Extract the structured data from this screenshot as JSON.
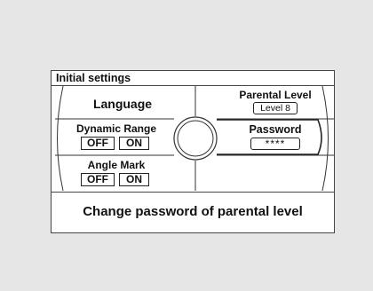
{
  "title": "Initial settings",
  "left": {
    "language": "Language",
    "dynamic_range": {
      "label": "Dynamic Range",
      "off": "OFF",
      "on": "ON"
    },
    "angle_mark": {
      "label": "Angle Mark",
      "off": "OFF",
      "on": "ON"
    }
  },
  "right": {
    "parental_level": {
      "label": "Parental Level",
      "value": "Level 8"
    },
    "password": {
      "label": "Password",
      "value": "****"
    }
  },
  "footer": "Change password of parental level"
}
